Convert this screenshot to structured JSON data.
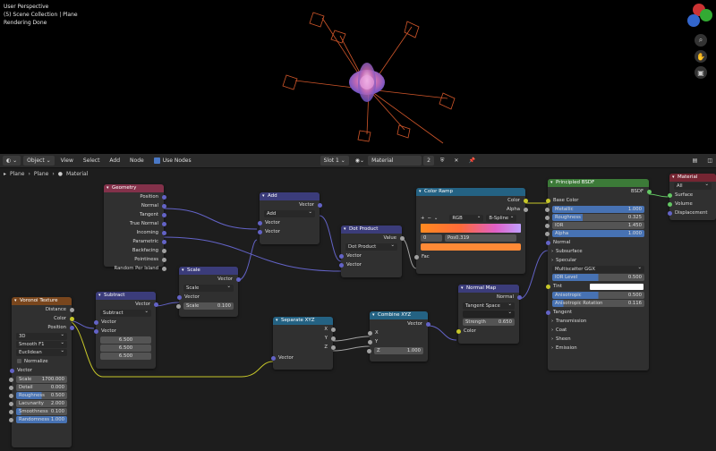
{
  "viewport": {
    "line1": "User Perspective",
    "line2": "(5) Scene Collection | Plane",
    "line3": "Rendering Done"
  },
  "header": {
    "object_label": "Object",
    "menu": [
      "View",
      "Select",
      "Add",
      "Node"
    ],
    "use_nodes": "Use Nodes",
    "slot": "Slot 1",
    "material": "Material",
    "users": "2"
  },
  "breadcrumb": [
    "Plane",
    "Plane",
    "Material"
  ],
  "nodes": {
    "geometry": {
      "title": "Geometry",
      "outputs": [
        "Position",
        "Normal",
        "Tangent",
        "True Normal",
        "Incoming",
        "Parametric",
        "Backfacing",
        "Pointiness",
        "Random Per Island"
      ]
    },
    "add": {
      "title": "Add",
      "out": "Vector",
      "op": "Add",
      "in1": "Vector",
      "in2": "Vector"
    },
    "scale": {
      "title": "Scale",
      "out": "Vector",
      "op": "Scale",
      "in1": "Vector",
      "scale_label": "Scale",
      "scale_val": "0.100"
    },
    "subtract": {
      "title": "Subtract",
      "out": "Vector",
      "op": "Subtract",
      "in1": "Vector",
      "in2": "Vector",
      "v1": "6.500",
      "v2": "6.500",
      "v3": "6.500"
    },
    "dot": {
      "title": "Dot Product",
      "out": "Value",
      "op": "Dot Product",
      "in1": "Vector",
      "in2": "Vector"
    },
    "ramp": {
      "title": "Color Ramp",
      "out1": "Color",
      "out2": "Alpha",
      "mode": "RGB",
      "interp": "B-Spline",
      "index": "0",
      "pos_label": "Pos",
      "pos_val": "0.319",
      "in": "Fac"
    },
    "sepxyz": {
      "title": "Separate XYZ",
      "x": "X",
      "y": "Y",
      "z": "Z",
      "in": "Vector"
    },
    "combxyz": {
      "title": "Combine XYZ",
      "out": "Vector",
      "x": "X",
      "y": "Y",
      "z_label": "Z",
      "z_val": "1.000"
    },
    "normalmap": {
      "title": "Normal Map",
      "out": "Normal",
      "space": "Tangent Space",
      "strength_label": "Strength",
      "strength_val": "0.650",
      "in": "Color"
    },
    "bsdf": {
      "title": "Principled BSDF",
      "out": "BSDF",
      "base": "Base Color",
      "fields": [
        {
          "label": "Metallic",
          "val": "1.000"
        },
        {
          "label": "Roughness",
          "val": "0.325"
        },
        {
          "label": "IOR",
          "val": "1.450"
        },
        {
          "label": "Alpha",
          "val": "1.000"
        }
      ],
      "normal": "Normal",
      "subsurface": "Subsurface",
      "specular": "Specular",
      "ms": "Multiscatter GGX",
      "ior_level_label": "IOR Level",
      "ior_level_val": "0.500",
      "tint": "Tint",
      "aniso_label": "Anisotropic",
      "aniso_val": "0.500",
      "aniso_rot_label": "Anisotropic Rotation",
      "aniso_rot_val": "0.116",
      "tangent": "Tangent",
      "transmission": "Transmission",
      "coat": "Coat",
      "sheen": "Sheen",
      "emission": "Emission"
    },
    "output": {
      "title": "Material Output",
      "target": "All",
      "surface": "Surface",
      "volume": "Volume",
      "displacement": "Displacement"
    },
    "voronoi": {
      "title": "Voronoi Texture",
      "outs": [
        "Distance",
        "Color",
        "Position"
      ],
      "dim": "3D",
      "feature": "Smooth F1",
      "metric": "Euclidean",
      "normalize": "Normalize",
      "vector": "Vector",
      "fields": [
        {
          "label": "Scale",
          "val": "1700.000"
        },
        {
          "label": "Detail",
          "val": "0.000"
        },
        {
          "label": "Roughness",
          "val": "0.500"
        },
        {
          "label": "Lacunarity",
          "val": "2.000"
        },
        {
          "label": "Smoothness",
          "val": "0.100"
        },
        {
          "label": "Randomness",
          "val": "1.000"
        }
      ]
    }
  },
  "colors": {
    "geometry": "#83314a",
    "vector": "#3b3c7a",
    "converter": "#246283",
    "texture": "#79461d",
    "shader": "#3c7a38",
    "output": "#752532"
  }
}
